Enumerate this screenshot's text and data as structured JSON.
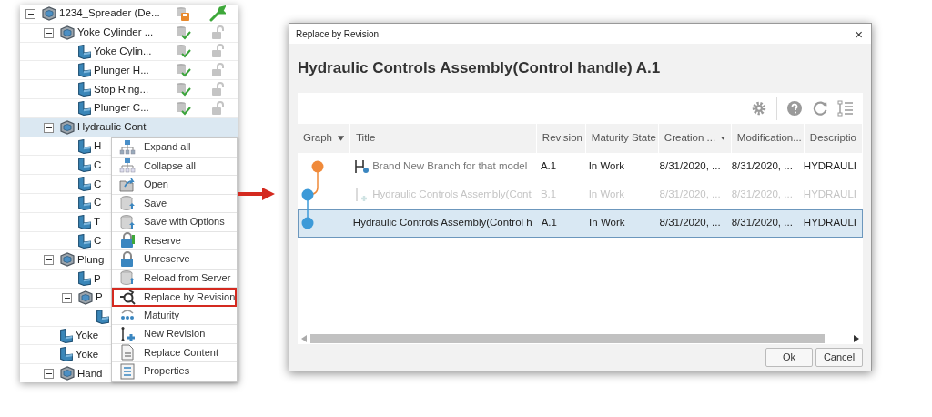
{
  "tree": [
    {
      "label": "1234_Spreader (De...",
      "kind": "assembly",
      "expanded": true,
      "modified": true,
      "children": [
        {
          "label": "Yoke Cylinder ...",
          "kind": "assembly",
          "expanded": true,
          "modified": false,
          "children": [
            {
              "label": "Yoke Cylin...",
              "kind": "part",
              "modified": false
            },
            {
              "label": "Plunger H...",
              "kind": "part",
              "modified": false
            },
            {
              "label": "Stop Ring...",
              "kind": "part",
              "modified": false
            },
            {
              "label": "Plunger C...",
              "kind": "part",
              "modified": false
            }
          ]
        },
        {
          "label": "Hydraulic Cont",
          "kind": "assembly",
          "expanded": true,
          "selected": true,
          "children": [
            {
              "label": "H",
              "kind": "part"
            },
            {
              "label": "C",
              "kind": "part"
            },
            {
              "label": "C",
              "kind": "part"
            },
            {
              "label": "C",
              "kind": "part"
            },
            {
              "label": "T",
              "kind": "part"
            },
            {
              "label": "C",
              "kind": "part"
            }
          ]
        },
        {
          "label": "Plung",
          "kind": "assembly",
          "expanded": true,
          "children": [
            {
              "label": "P",
              "kind": "part"
            },
            {
              "label": "P",
              "kind": "assembly",
              "expanded": true,
              "children": [
                {
                  "kind": "part"
                }
              ]
            }
          ]
        },
        {
          "label": "Yoke",
          "kind": "part"
        },
        {
          "label": "Yoke",
          "kind": "part"
        },
        {
          "label": "Hand",
          "kind": "assembly",
          "expanded": true
        }
      ]
    }
  ],
  "context_menu": [
    {
      "label": "Expand all",
      "kind": "expand",
      "highlighted": false
    },
    {
      "label": "Collapse all",
      "kind": "collapse",
      "highlighted": false
    },
    {
      "label": "Open",
      "kind": "open",
      "highlighted": false
    },
    {
      "label": "Save",
      "kind": "save",
      "highlighted": false
    },
    {
      "label": "Save with Options",
      "kind": "save-options",
      "highlighted": false
    },
    {
      "label": "Reserve",
      "kind": "reserve",
      "highlighted": false
    },
    {
      "label": "Unreserve",
      "kind": "unreserve",
      "highlighted": false
    },
    {
      "label": "Reload from Server",
      "kind": "reload",
      "highlighted": false
    },
    {
      "label": "Replace by Revision",
      "kind": "replace-revision",
      "highlighted": true
    },
    {
      "label": "Maturity",
      "kind": "maturity",
      "highlighted": false
    },
    {
      "label": "New Revision",
      "kind": "new-revision",
      "highlighted": false
    },
    {
      "label": "Replace Content",
      "kind": "replace-content",
      "highlighted": false
    },
    {
      "label": "Properties",
      "kind": "properties",
      "highlighted": false
    }
  ],
  "dialog": {
    "title": "Replace by Revision",
    "close": "×",
    "heading": "Hydraulic Controls Assembly(Control handle) A.1",
    "columns": [
      {
        "label": "Graph",
        "sort": true
      },
      {
        "label": "Title"
      },
      {
        "label": "Revision"
      },
      {
        "label": "Maturity State"
      },
      {
        "label": "Creation ...",
        "sort": true
      },
      {
        "label": "Modification..."
      },
      {
        "label": "Descriptio"
      }
    ],
    "rows": [
      {
        "kind": "branch",
        "color": "#f08a3a",
        "title": "Brand New Branch for that model",
        "revision": "A.1",
        "maturity": "In Work",
        "created": "8/31/2020, ...",
        "modified": "8/31/2020, ...",
        "description": "HYDRAULI",
        "disabled": false,
        "selected": false
      },
      {
        "kind": "revision",
        "color": "#3d9ad8",
        "title": "Hydraulic Controls Assembly(Cont",
        "revision": "B.1",
        "maturity": "In Work",
        "created": "8/31/2020, ...",
        "modified": "8/31/2020, ...",
        "description": "HYDRAULI",
        "disabled": true,
        "selected": false
      },
      {
        "kind": "current",
        "color": "#3d9ad8",
        "title": "Hydraulic Controls Assembly(Control h",
        "revision": "A.1",
        "maturity": "In Work",
        "created": "8/31/2020, ...",
        "modified": "8/31/2020, ...",
        "description": "HYDRAULI",
        "disabled": false,
        "selected": true
      }
    ],
    "buttons": [
      "Ok",
      "Cancel"
    ]
  }
}
